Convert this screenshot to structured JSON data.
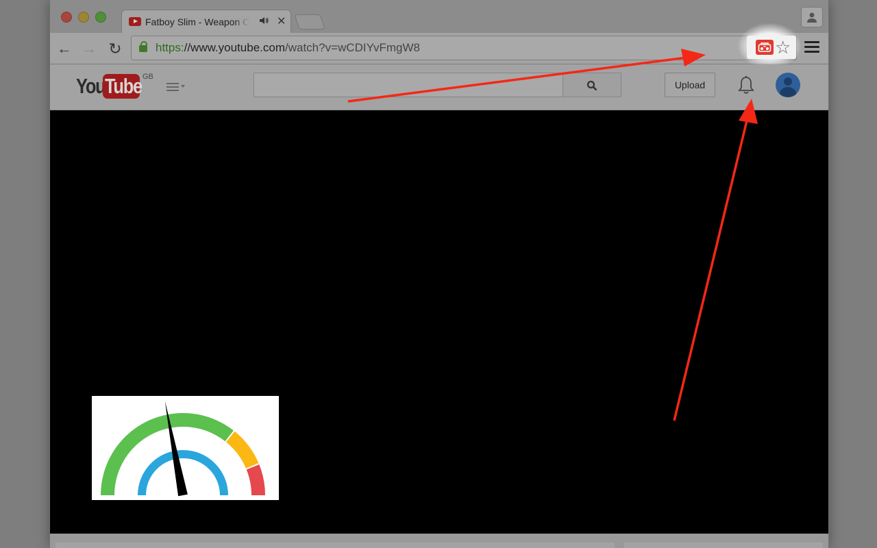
{
  "browser": {
    "tab": {
      "title": "Fatboy Slim - Weapon Of Choice",
      "audio_icon": "speaker-icon",
      "close_glyph": "✕"
    },
    "toolbar": {
      "back_glyph": "←",
      "forward_glyph": "→",
      "reload_glyph": "↻",
      "url_scheme": "https:",
      "url_host": "//www.youtube.com",
      "url_path": "/watch?v=wCDIYvFmgW8",
      "extension_icon": "boombox-icon",
      "star_glyph": "☆"
    }
  },
  "youtube": {
    "logo_you": "You",
    "logo_tube": "Tube",
    "region": "GB",
    "search_placeholder": "",
    "upload_label": "Upload"
  },
  "gauge": {
    "needle_fraction": 0.44,
    "colors": {
      "outer_green": "#5cc04f",
      "outer_yellow": "#fbb814",
      "outer_red": "#e5484d",
      "inner_blue": "#2aa6dd",
      "needle": "#000000"
    }
  },
  "annotations": {
    "arrow_color": "#f42816"
  },
  "colors": {
    "player_background": "#000000"
  }
}
